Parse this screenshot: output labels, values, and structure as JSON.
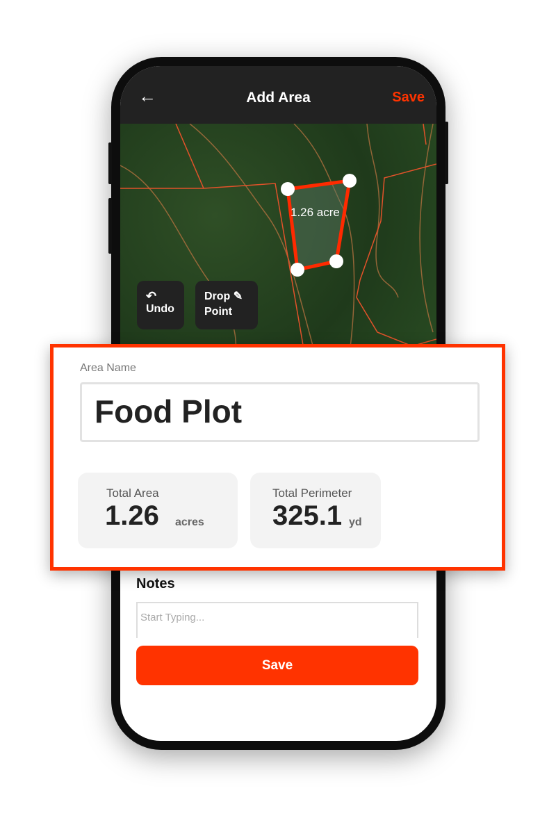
{
  "header": {
    "title": "Add Area",
    "save_label": "Save",
    "back_icon": "arrow-left-icon"
  },
  "map": {
    "polygon_label": "1.26 acre",
    "undo_label": "Undo",
    "drop_point_label_1": "Drop",
    "drop_point_label_2": "Point",
    "boundary_color": "#ff3300"
  },
  "form": {
    "area_name_label": "Area Name",
    "area_name_value": "Food Plot",
    "total_area": {
      "label": "Total Area",
      "value": "1.26",
      "unit": "acres"
    },
    "total_perimeter": {
      "label": "Total Perimeter",
      "value": "325.1",
      "unit": "yd"
    },
    "notes_label": "Notes",
    "notes_placeholder": "Start Typing...",
    "save_label": "Save"
  },
  "colors": {
    "accent": "#ff3300",
    "header_bg": "#222222"
  }
}
